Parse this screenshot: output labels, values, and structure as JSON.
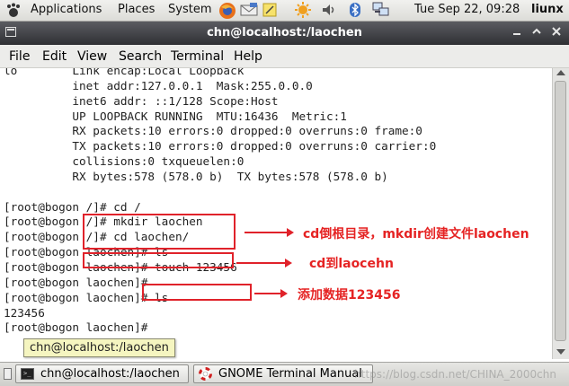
{
  "top_panel": {
    "menus": [
      "Applications",
      "Places",
      "System"
    ],
    "clock": "Tue Sep 22, 09:28",
    "user": "liunx",
    "icons": [
      "gnome-foot-icon",
      "firefox-icon",
      "mail-icon",
      "notes-icon",
      "update-icon",
      "volume-icon",
      "bluetooth-icon",
      "network-icon"
    ]
  },
  "window": {
    "title": "chn@localhost:/laochen",
    "menu": [
      "File",
      "Edit",
      "View",
      "Search",
      "Terminal",
      "Help"
    ]
  },
  "terminal": {
    "lines": [
      "lo        Link encap:Local Loopback",
      "          inet addr:127.0.0.1  Mask:255.0.0.0",
      "          inet6 addr: ::1/128 Scope:Host",
      "          UP LOOPBACK RUNNING  MTU:16436  Metric:1",
      "          RX packets:10 errors:0 dropped:0 overruns:0 frame:0",
      "          TX packets:10 errors:0 dropped:0 overruns:0 carrier:0",
      "          collisions:0 txqueuelen:0",
      "          RX bytes:578 (578.0 b)  TX bytes:578 (578.0 b)",
      "",
      "[root@bogon /]# cd /",
      "[root@bogon /]# mkdir laochen",
      "[root@bogon /]# cd laochen/",
      "[root@bogon laochen]# ls",
      "[root@bogon laochen]# touch 123456",
      "[root@bogon laochen]#",
      "[root@bogon laochen]# ls",
      "123456",
      "[root@bogon laochen]#"
    ]
  },
  "annotations": {
    "note1": "cd倒根目录，mkdir创建文件laochen",
    "note2": "cd到laocehn",
    "note3": "添加数据123456",
    "color": "#e0222a"
  },
  "tooltip": "chn@localhost:/laochen",
  "taskbar": {
    "items": [
      "chn@localhost:/laochen",
      "GNOME Terminal Manual"
    ],
    "watermark": "https://blog.csdn.net/CHINA_2000chn"
  }
}
